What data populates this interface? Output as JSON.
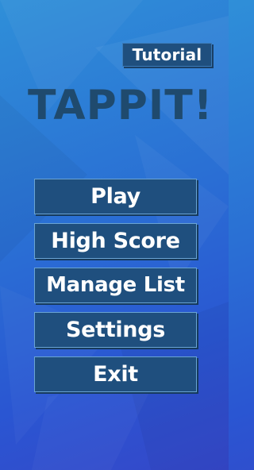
{
  "colors": {
    "background_top": "#2f8fd8",
    "background_bottom": "#3547c9",
    "button_fill": "#1f4f7e",
    "button_text": "#ffffff",
    "title_color": "#1f4a6e"
  },
  "header": {
    "tutorial_label": "Tutorial",
    "title": "TAPPIT!"
  },
  "menu": {
    "items": [
      {
        "label": "Play"
      },
      {
        "label": "High Score"
      },
      {
        "label": "Manage List"
      },
      {
        "label": "Settings"
      },
      {
        "label": "Exit"
      }
    ]
  }
}
